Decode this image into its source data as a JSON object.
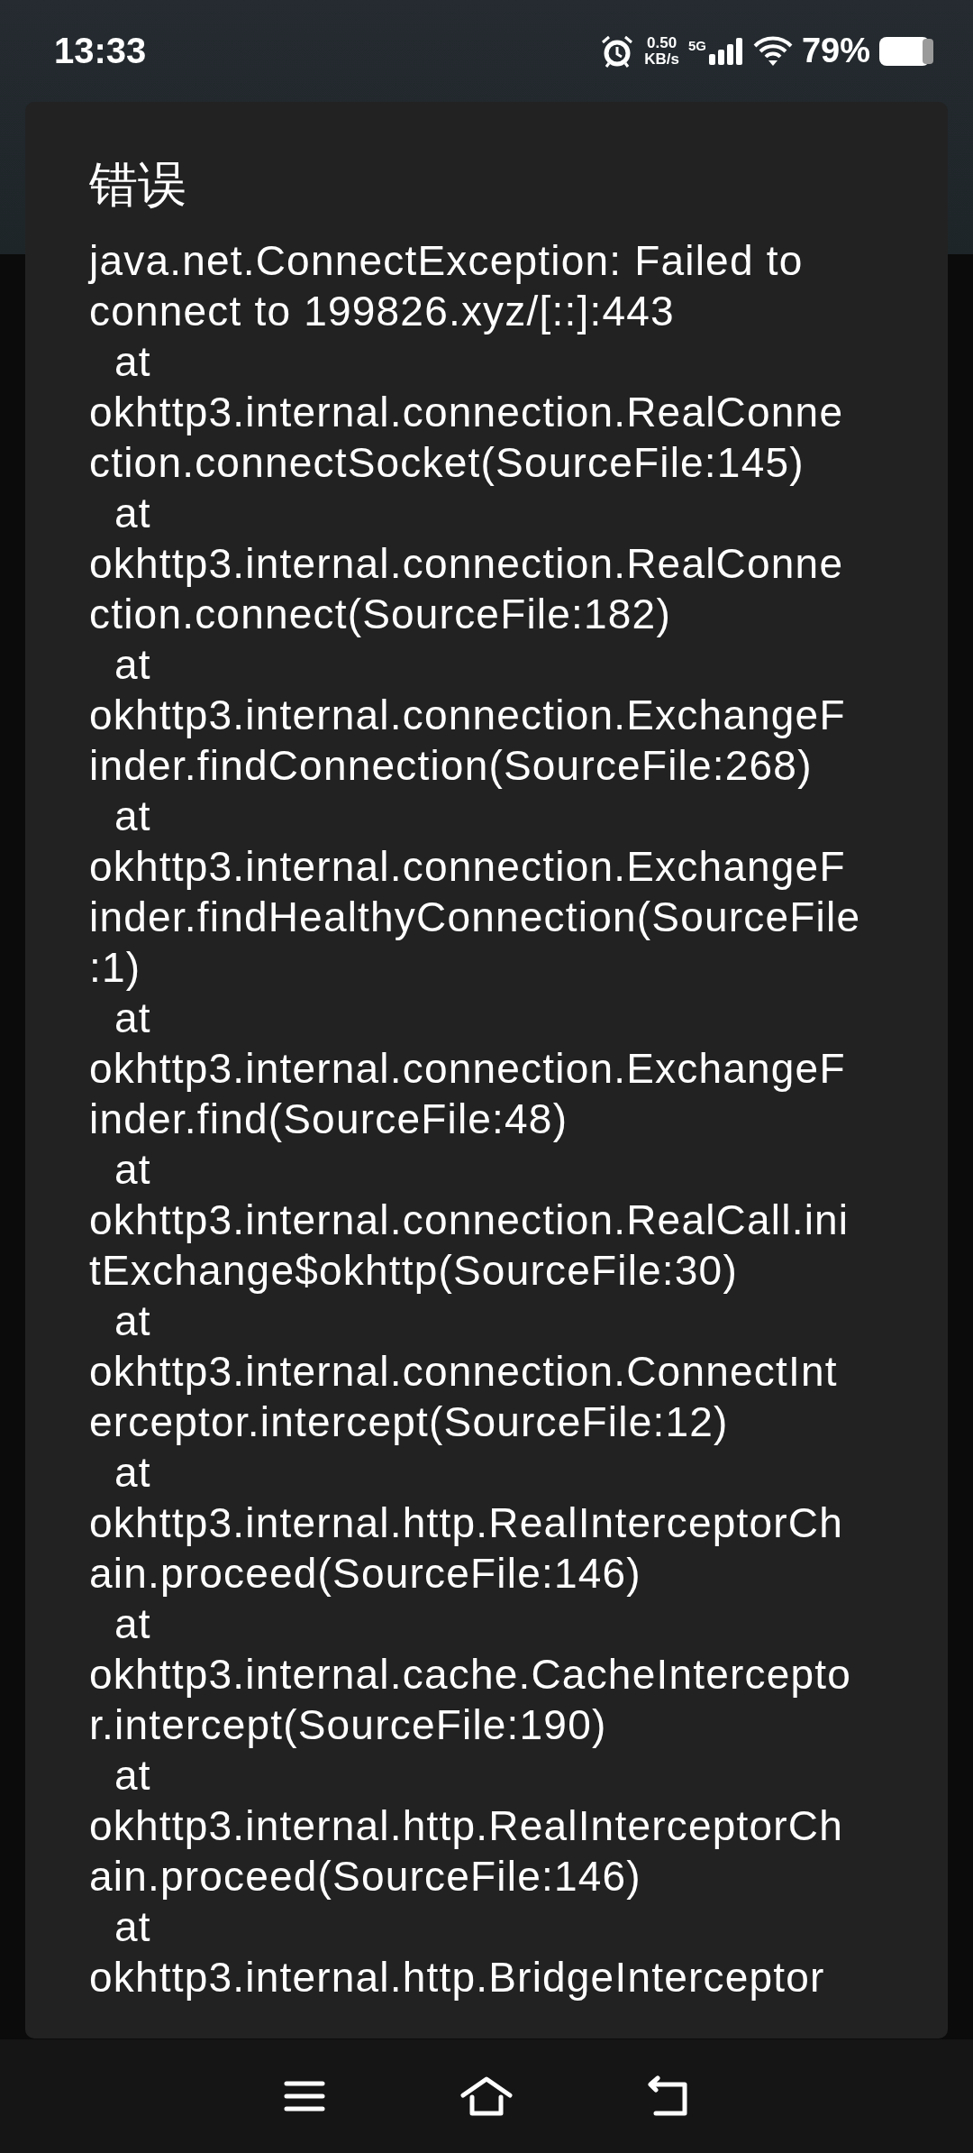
{
  "status_bar": {
    "time": "13:33",
    "net_speed_value": "0.50",
    "net_speed_unit": "KB/s",
    "network_type": "5G",
    "battery": "79%"
  },
  "dialog": {
    "title": "错误",
    "message_lines": [
      "java.net.ConnectException: Failed to",
      "connect to 199826.xyz/[::]:443",
      "  at",
      "okhttp3.internal.connection.RealConne",
      "ction.connectSocket(SourceFile:145)",
      "  at",
      "okhttp3.internal.connection.RealConne",
      "ction.connect(SourceFile:182)",
      "  at",
      "okhttp3.internal.connection.ExchangeF",
      "inder.findConnection(SourceFile:268)",
      "  at",
      "okhttp3.internal.connection.ExchangeF",
      "inder.findHealthyConnection(SourceFile",
      ":1)",
      "  at",
      "okhttp3.internal.connection.ExchangeF",
      "inder.find(SourceFile:48)",
      "  at",
      "okhttp3.internal.connection.RealCall.ini",
      "tExchange$okhttp(SourceFile:30)",
      "  at",
      "okhttp3.internal.connection.ConnectInt",
      "erceptor.intercept(SourceFile:12)",
      "  at",
      "okhttp3.internal.http.RealInterceptorCh",
      "ain.proceed(SourceFile:146)",
      "  at",
      "okhttp3.internal.cache.CacheIntercepto",
      "r.intercept(SourceFile:190)",
      "  at",
      "okhttp3.internal.http.RealInterceptorCh",
      "ain.proceed(SourceFile:146)",
      "  at",
      "okhttp3.internal.http.BridgeInterceptor"
    ]
  }
}
